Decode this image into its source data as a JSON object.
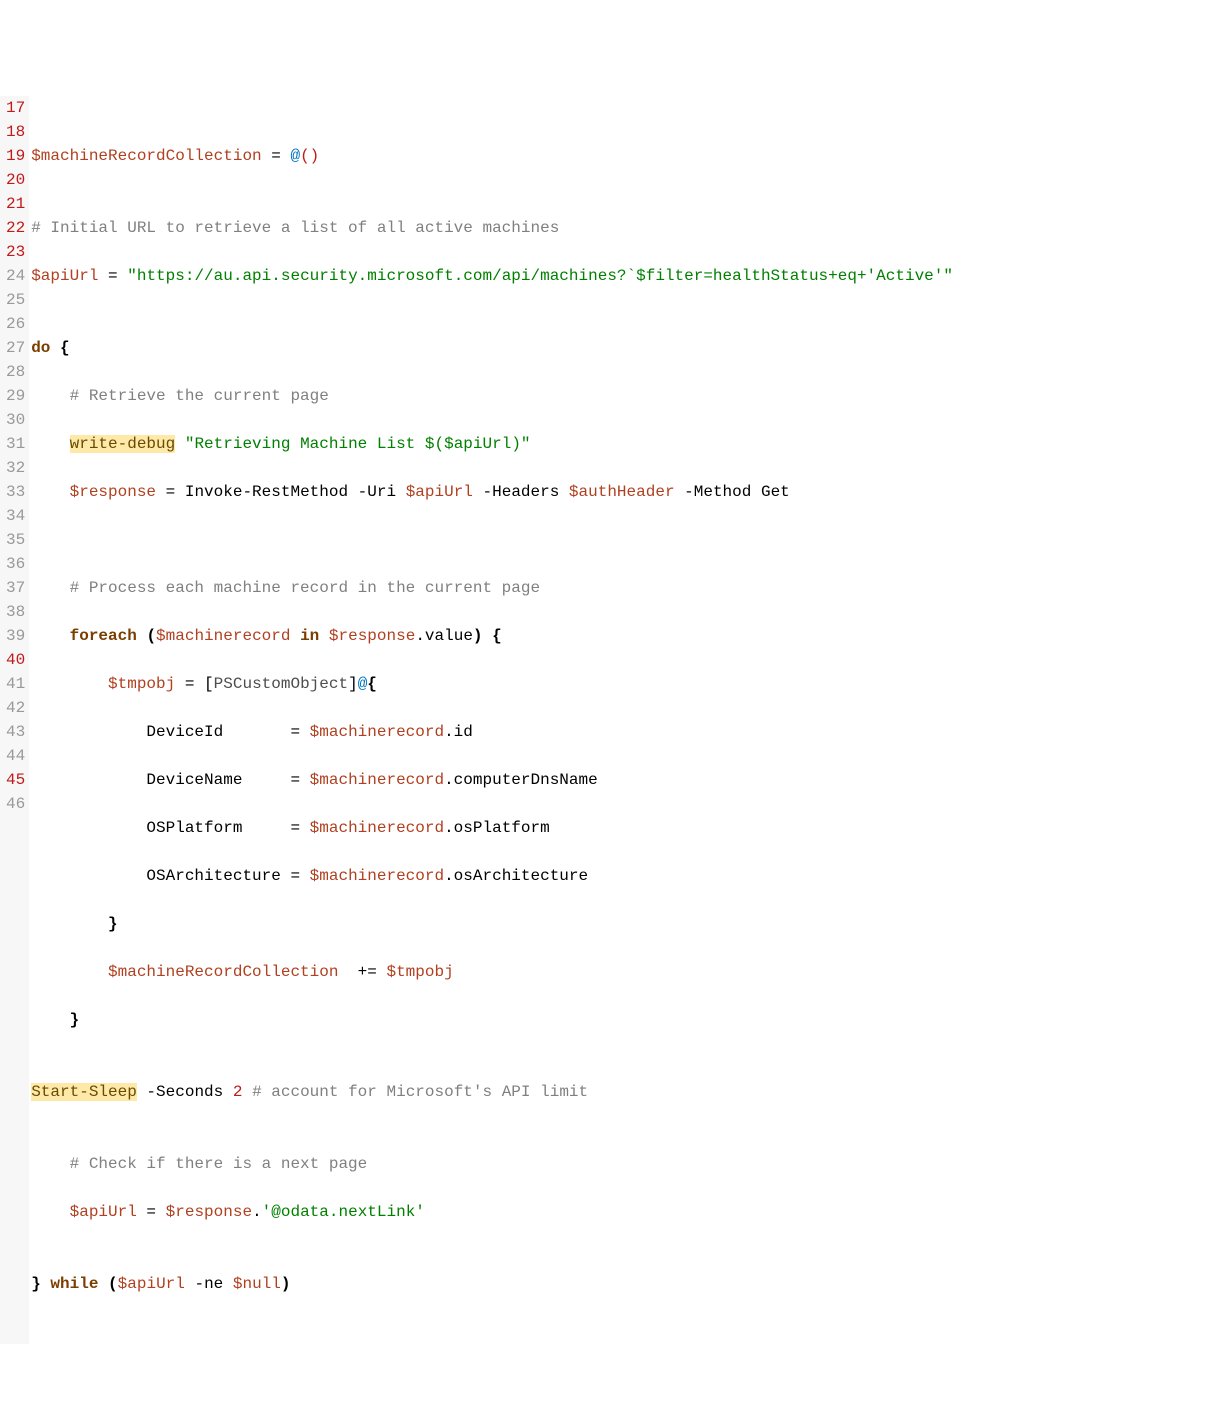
{
  "gutter": {
    "start": 17,
    "end": 46,
    "redLines": [
      17,
      18,
      19,
      20,
      21,
      22,
      23,
      40,
      45
    ]
  },
  "code": {
    "l17": "",
    "l18": {
      "var": "$machineRecordCollection",
      "eq": " = ",
      "at": "@",
      "open": "(",
      "close": ")"
    },
    "l19": "",
    "l20": "# Initial URL to retrieve a list of all active machines",
    "l21": {
      "var": "$apiUrl",
      "eq": " = ",
      "str": "\"https://au.api.security.microsoft.com/api/machines?`$filter=healthStatus+eq+'Active'\""
    },
    "l22": "",
    "l23": {
      "kw": "do",
      "sp": " ",
      "brace": "{"
    },
    "l24": "    # Retrieve the current page",
    "l25": {
      "indent": "    ",
      "cmd": "write-debug",
      "sp": " ",
      "strOpen": "\"Retrieving Machine List ",
      "interpO": "$(",
      "ivar": "$apiUrl",
      "interpC": ")",
      "strClose": "\""
    },
    "l26": {
      "indent": "    ",
      "var": "$response",
      "eq": " = ",
      "cmd": "Invoke-RestMethod",
      "p1": " -Uri ",
      "v1": "$apiUrl",
      "p2": " -Headers ",
      "v2": "$authHeader",
      "p3": " -Method Get"
    },
    "l27": "",
    "l28": "",
    "l29": "    # Process each machine record in the current page",
    "l30": {
      "indent": "    ",
      "kw1": "foreach",
      "sp1": " ",
      "po": "(",
      "var1": "$machinerecord",
      "sp2": " ",
      "kw2": "in",
      "sp3": " ",
      "var2": "$response",
      "dot": ".value",
      "pc": ")",
      "sp4": " ",
      "brace": "{"
    },
    "l31": {
      "indent": "        ",
      "var": "$tmpobj",
      "eq": " = ",
      "typeO": "[",
      "type": "PSCustomObject",
      "typeC": "]",
      "at": "@",
      "brace": "{"
    },
    "l32": {
      "indent": "            ",
      "key": "DeviceId       = ",
      "var": "$machinerecord",
      "prop": ".id"
    },
    "l33": {
      "indent": "            ",
      "key": "DeviceName     = ",
      "var": "$machinerecord",
      "prop": ".computerDnsName"
    },
    "l34": {
      "indent": "            ",
      "key": "OSPlatform     = ",
      "var": "$machinerecord",
      "prop": ".osPlatform"
    },
    "l35": {
      "indent": "            ",
      "key": "OSArchitecture = ",
      "var": "$machinerecord",
      "prop": ".osArchitecture"
    },
    "l36": {
      "indent": "        ",
      "brace": "}"
    },
    "l37": {
      "indent": "        ",
      "var": "$machineRecordCollection",
      "op": "  += ",
      "var2": "$tmpobj"
    },
    "l38": {
      "indent": "    ",
      "brace": "}"
    },
    "l39": "",
    "l40": {
      "cmd": "Start-Sleep",
      "p": " -Seconds ",
      "num": "2",
      "sp": " ",
      "comment": "# account for Microsoft's API limit"
    },
    "l41": "",
    "l42": "    # Check if there is a next page",
    "l43": {
      "indent": "    ",
      "var": "$apiUrl",
      "eq": " = ",
      "var2": "$response",
      "dot": ".",
      "str": "'@odata.nextLink'"
    },
    "l44": "",
    "l45": {
      "brace1": "}",
      "sp1": " ",
      "kw": "while",
      "sp2": " ",
      "po": "(",
      "var": "$apiUrl",
      "op": " -ne ",
      "var2": "$null",
      "pc": ")"
    },
    "l46": ""
  }
}
